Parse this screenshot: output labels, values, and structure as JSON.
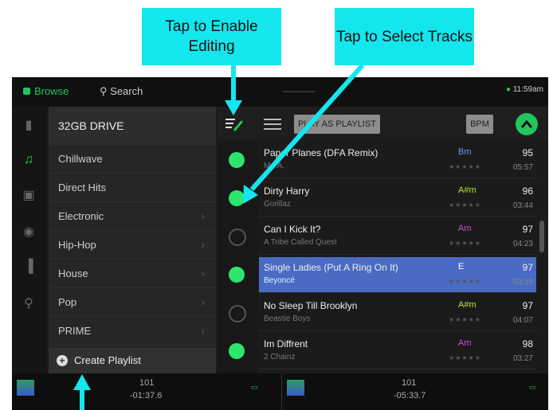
{
  "callouts": {
    "editing": "Tap to Enable Editing",
    "select": "Tap to Select Tracks"
  },
  "topbar": {
    "browse": "Browse",
    "search": "Search",
    "time": "11:59am"
  },
  "left_panel": {
    "drive": "32GB DRIVE",
    "crates": [
      {
        "label": "Chillwave",
        "chevron": false
      },
      {
        "label": "Direct Hits",
        "chevron": false
      },
      {
        "label": "Electronic",
        "chevron": true
      },
      {
        "label": "Hip-Hop",
        "chevron": true
      },
      {
        "label": "House",
        "chevron": true
      },
      {
        "label": "Pop",
        "chevron": true
      },
      {
        "label": "PRIME",
        "chevron": true
      }
    ],
    "create_playlist": "Create Playlist"
  },
  "toolbar": {
    "play_as_playlist": "PLAY AS PLAYLIST",
    "bpm": "BPM"
  },
  "tracks": [
    {
      "title": "Paper Planes (DFA Remix)",
      "artist": "M.I.A.",
      "key": "Bm",
      "key_color": "#5aa0ff",
      "bpm": "95",
      "time": "05:57",
      "selected": true,
      "active": false
    },
    {
      "title": "Dirty Harry",
      "artist": "Gorillaz",
      "key": "A#m",
      "key_color": "#b8e63c",
      "bpm": "96",
      "time": "03:44",
      "selected": true,
      "active": false
    },
    {
      "title": "Can I Kick It?",
      "artist": "A Tribe Called Quest",
      "key": "Am",
      "key_color": "#d24de0",
      "bpm": "97",
      "time": "04:23",
      "selected": false,
      "active": false
    },
    {
      "title": "Single Ladies (Put A Ring On It)",
      "artist": "Beyoncé",
      "key": "E",
      "key_color": "#ffffff",
      "bpm": "97",
      "time": "03:19",
      "selected": true,
      "active": true
    },
    {
      "title": "No Sleep Till Brooklyn",
      "artist": "Beastie Boys",
      "key": "A#m",
      "key_color": "#b8e63c",
      "bpm": "97",
      "time": "04:07",
      "selected": false,
      "active": false
    },
    {
      "title": "Im Diffrent",
      "artist": "2 Chainz",
      "key": "Am",
      "key_color": "#d24de0",
      "bpm": "98",
      "time": "03:27",
      "selected": true,
      "active": false
    }
  ],
  "decks": [
    {
      "bpm": "101",
      "time": "-01:37.6"
    },
    {
      "bpm": "101",
      "time": "-05:33.7"
    }
  ]
}
